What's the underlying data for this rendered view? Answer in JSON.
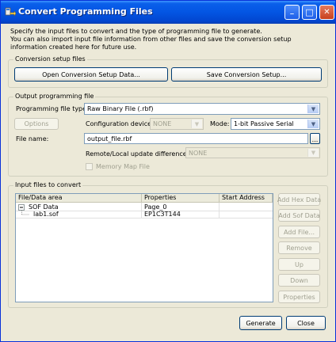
{
  "window": {
    "title": "Convert Programming Files",
    "minimize": "_",
    "maximize": "□",
    "close": "✕"
  },
  "intro": {
    "line1": "Specify the input files to convert and the type of programming file to generate.",
    "line2": "You can also import input file information from other files and save the conversion setup information created here for future use."
  },
  "conversion_setup": {
    "legend": "Conversion setup files",
    "open_button": "Open Conversion Setup Data...",
    "save_button": "Save Conversion Setup..."
  },
  "output": {
    "legend": "Output programming file",
    "type_label": "Programming file type:",
    "type_value": "Raw Binary File (.rbf)",
    "options_button": "Options",
    "config_device_label": "Configuration device:",
    "config_device_value": "NONE",
    "mode_label": "Mode:",
    "mode_value": "1-bit Passive Serial",
    "file_name_label": "File name:",
    "file_name_value": "output_file.rbf",
    "browse_label": "...",
    "remote_local_label": "Remote/Local update difference file:",
    "remote_local_value": "NONE",
    "memory_map_label": "Memory Map File"
  },
  "input": {
    "legend": "Input files to convert",
    "columns": [
      "File/Data area",
      "Properties",
      "Start Address"
    ],
    "rows": [
      {
        "name": "SOF Data",
        "properties": "Page_0",
        "start": ""
      },
      {
        "name": "lab1.sof",
        "properties": "EP1C3T144",
        "start": ""
      }
    ],
    "buttons": {
      "add_hex": "Add Hex Data",
      "add_sof": "Add Sof Data",
      "add_file": "Add File...",
      "remove": "Remove",
      "up": "Up",
      "down": "Down",
      "properties": "Properties"
    }
  },
  "footer": {
    "generate": "Generate",
    "close": "Close"
  }
}
